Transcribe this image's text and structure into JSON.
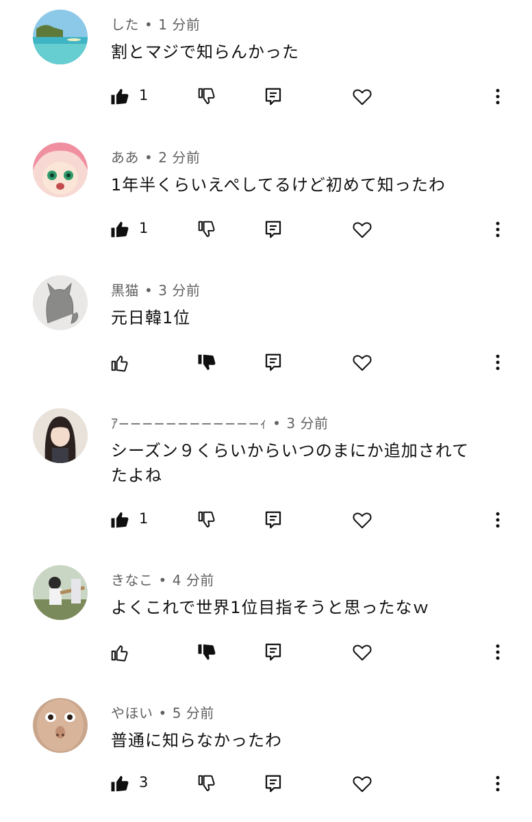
{
  "comments": [
    {
      "author": "した",
      "time": "1 分前",
      "text": "割とマジで知らんかった",
      "likes": "1",
      "liked": true,
      "disliked": false
    },
    {
      "author": "ああ",
      "time": "2 分前",
      "text": "1年半くらいえぺしてるけど初めて知ったわ",
      "likes": "1",
      "liked": true,
      "disliked": false
    },
    {
      "author": "黒猫",
      "time": "3 分前",
      "text": "元日韓1位",
      "likes": "",
      "liked": false,
      "disliked": true
    },
    {
      "author": "ｱ−−−−−−−−−−−−ｨ",
      "time": "3 分前",
      "text": "シーズン９くらいからいつのまにか追加されてたよね",
      "likes": "1",
      "liked": true,
      "disliked": false
    },
    {
      "author": "きなこ",
      "time": "4 分前",
      "text": "よくこれで世界1位目指そうと思ったなｗ",
      "likes": "",
      "liked": false,
      "disliked": true
    },
    {
      "author": "やほい",
      "time": "5 分前",
      "text": "普通に知らなかったわ",
      "likes": "3",
      "liked": true,
      "disliked": false
    }
  ],
  "icons": {
    "like": "thumbs-up-icon",
    "dislike": "thumbs-down-icon",
    "reply": "reply-icon",
    "heart": "heart-icon",
    "more": "more-vert-icon"
  },
  "colors": {
    "meta": "#606060",
    "text": "#0f0f0f"
  }
}
